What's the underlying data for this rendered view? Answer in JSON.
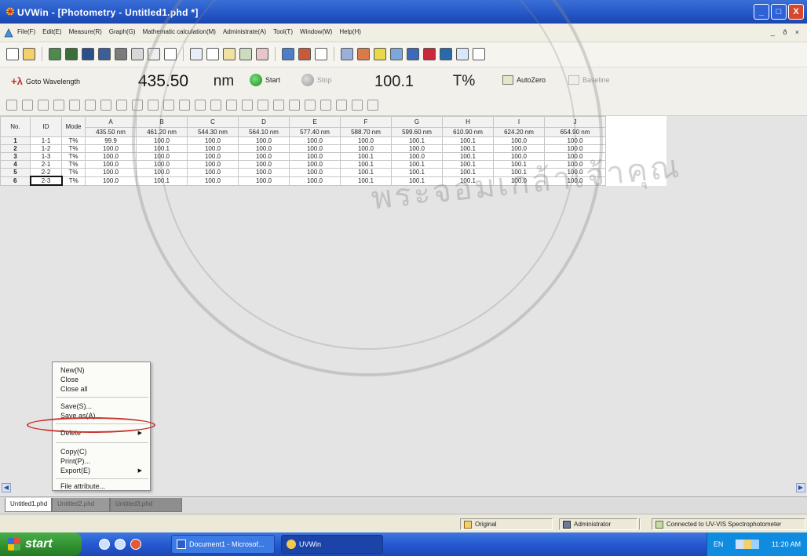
{
  "window": {
    "title": "UVWin - [Photometry - Untitled1.phd *]",
    "controls": [
      "_",
      "□",
      "X"
    ]
  },
  "menu": {
    "items": [
      "File(F)",
      "Edit(E)",
      "Measure(R)",
      "Graph(G)",
      "Mathematic calculation(M)",
      "Administrate(A)",
      "Tool(T)",
      "Window(W)",
      "Help(H)"
    ],
    "mdi_controls": "_ ð ×"
  },
  "measure_bar": {
    "goto_label": "Goto Wavelength",
    "wavelength_value": "435.50",
    "wavelength_unit": "nm",
    "start_label": "Start",
    "stop_label": "Stop",
    "reading_value": "100.1",
    "reading_unit": "T%",
    "autozero_label": "AutoZero",
    "baseline_label": "Baseline"
  },
  "grid": {
    "headers_row1": [
      "No.",
      "ID",
      "Mode",
      "A",
      "B",
      "C",
      "D",
      "E",
      "F",
      "G",
      "H",
      "I",
      "J"
    ],
    "wavelengths": [
      "435.50 nm",
      "461.20 nm",
      "544.30 nm",
      "564.10 nm",
      "577.40 nm",
      "588.70 nm",
      "599.60 nm",
      "610.90 nm",
      "624.20 nm",
      "654.90 nm"
    ],
    "rows": [
      {
        "no": "1",
        "id": "1-1",
        "mode": "T%",
        "values": [
          "99.9",
          "100.0",
          "100.0",
          "100.0",
          "100.0",
          "100.0",
          "100.1",
          "100.1",
          "100.0",
          "100.0"
        ]
      },
      {
        "no": "2",
        "id": "1-2",
        "mode": "T%",
        "values": [
          "100.0",
          "100.1",
          "100.0",
          "100.0",
          "100.0",
          "100.0",
          "100.0",
          "100.1",
          "100.0",
          "100.0"
        ]
      },
      {
        "no": "3",
        "id": "1-3",
        "mode": "T%",
        "values": [
          "100.0",
          "100.0",
          "100.0",
          "100.0",
          "100.0",
          "100.1",
          "100.0",
          "100.1",
          "100.0",
          "100.0"
        ]
      },
      {
        "no": "4",
        "id": "2-1",
        "mode": "T%",
        "values": [
          "100.0",
          "100.0",
          "100.0",
          "100.0",
          "100.0",
          "100.1",
          "100.1",
          "100.1",
          "100.1",
          "100.0"
        ]
      },
      {
        "no": "5",
        "id": "2-2",
        "mode": "T%",
        "values": [
          "100.0",
          "100.0",
          "100.0",
          "100.0",
          "100.0",
          "100.1",
          "100.1",
          "100.1",
          "100.1",
          "100.0"
        ]
      },
      {
        "no": "6",
        "id": "2-3",
        "mode": "T%",
        "values": [
          "100.0",
          "100.1",
          "100.0",
          "100.0",
          "100.0",
          "100.1",
          "100.1",
          "100.1",
          "100.0",
          "100.0"
        ]
      }
    ]
  },
  "context_menu": {
    "new": "New(N)",
    "close": "Close",
    "close_all": "Close all",
    "save": "Save(S)...",
    "save_as": "Save as(A)...",
    "delete": "Delete",
    "copy": "Copy(C)",
    "print": "Print(P)...",
    "export": "Export(E)",
    "file_attribute": "File attribute..."
  },
  "tabs": [
    "Untitled1.phd",
    "Untitled2.phd",
    "Untitled3.phd"
  ],
  "status": {
    "original": "Original",
    "user": "Administrator",
    "connection": "Connected to UV-VIS Spectrophotometer"
  },
  "taskbar": {
    "start": "start",
    "document_task": "Document1 - Microsof...",
    "uvwin_task": "UVWin",
    "lang": "EN",
    "clock": "11:20 AM"
  },
  "watermark": {
    "text": "พระจอมเกล้าเจ้าคุณ"
  },
  "colors": {
    "titlebar": "#2456c6",
    "start_button": "#2f8f2f",
    "highlight_ellipse": "#c9332d"
  }
}
